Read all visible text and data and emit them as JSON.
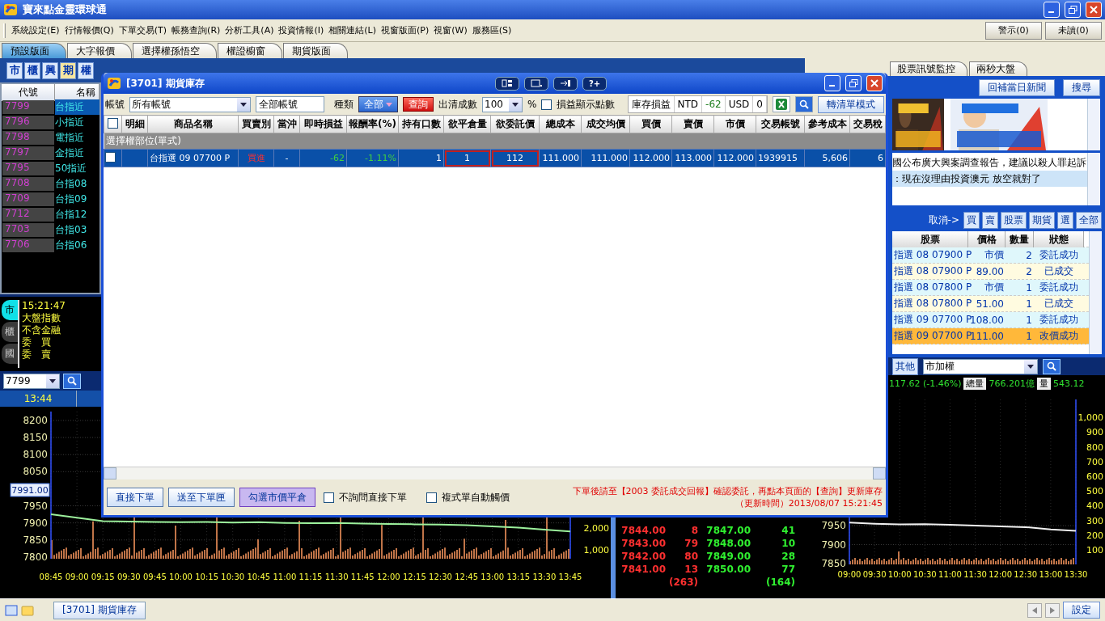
{
  "app": {
    "title": "寶來點金靈環球通"
  },
  "menu": [
    "系統設定(E)",
    "行情報價(Q)",
    "下單交易(T)",
    "帳務查詢(R)",
    "分析工具(A)",
    "投資情報(I)",
    "相關連結(L)",
    "視窗版面(P)",
    "視窗(W)",
    "服務區(S)"
  ],
  "alerts": [
    "警示(0)",
    "未讀(0)"
  ],
  "layout_tabs": [
    {
      "label": "預設版面",
      "selected": true
    },
    {
      "label": "大字報價",
      "selected": false
    },
    {
      "label": "選擇權孫悟空",
      "selected": false
    },
    {
      "label": "權證櫥窗",
      "selected": false
    },
    {
      "label": "期貨版面",
      "selected": false
    }
  ],
  "market_buttons": [
    {
      "label": "市",
      "selected": false
    },
    {
      "label": "櫃",
      "selected": false
    },
    {
      "label": "興",
      "selected": false
    },
    {
      "label": "期",
      "selected": true
    },
    {
      "label": "權",
      "selected": false
    }
  ],
  "quote_list": {
    "columns": [
      "代號",
      "名稱"
    ],
    "rows": [
      {
        "code": "7799",
        "name": "台指近",
        "selected": true
      },
      {
        "code": "7796",
        "name": "小指近",
        "selected": false
      },
      {
        "code": "7798",
        "name": "電指近",
        "selected": false
      },
      {
        "code": "7797",
        "name": "金指近",
        "selected": false
      },
      {
        "code": "7795",
        "name": "50指近",
        "selected": false
      },
      {
        "code": "7708",
        "name": "台指08",
        "selected": false
      },
      {
        "code": "7709",
        "name": "台指09",
        "selected": false
      },
      {
        "code": "7712",
        "name": "台指12",
        "selected": false
      },
      {
        "code": "7703",
        "name": "台指03",
        "selected": false
      },
      {
        "code": "7706",
        "name": "台指06",
        "selected": false
      }
    ]
  },
  "index_panel": {
    "tabs": [
      {
        "label": "市",
        "selected": true
      },
      {
        "label": "櫃",
        "selected": false
      },
      {
        "label": "國",
        "selected": false
      }
    ],
    "lines": [
      "15:21:47",
      "大盤指數",
      "不含金融",
      "委　買",
      "委　賣"
    ]
  },
  "symbol_combo": {
    "value": "7799"
  },
  "chart_time": "13:44",
  "price_chart": {
    "chart_data": {
      "type": "line",
      "categories": [
        "08:45",
        "09:00",
        "09:15",
        "09:30",
        "09:45",
        "10:00",
        "10:15",
        "10:30",
        "10:45",
        "11:00",
        "11:15",
        "11:30",
        "11:45",
        "12:00",
        "12:15",
        "12:30",
        "12:45",
        "13:00",
        "13:15",
        "13:30",
        "13:45"
      ],
      "yticks": [
        7800,
        7850,
        7900,
        7950,
        8050,
        8100,
        8150,
        8200
      ],
      "ylim": [
        7795,
        8226
      ],
      "grid": true,
      "series": [
        {
          "color": "#9cf09c",
          "values": [
            7925,
            7915,
            7905,
            7904,
            7903,
            7902,
            7903,
            7901,
            7902,
            7900,
            7899,
            7900,
            7898,
            7897,
            7896,
            7895,
            7893,
            7890,
            7886,
            7880,
            7875
          ]
        }
      ]
    },
    "marker": "7991.00",
    "volume_ticks": [
      "2,000",
      "1,000"
    ]
  },
  "order_book": {
    "rows": [
      {
        "bid": "7844.00",
        "bid_qty": "8",
        "ask": "7847.00",
        "ask_qty": "41"
      },
      {
        "bid": "7843.00",
        "bid_qty": "79",
        "ask": "7848.00",
        "ask_qty": "10"
      },
      {
        "bid": "7842.00",
        "bid_qty": "80",
        "ask": "7849.00",
        "ask_qty": "28"
      },
      {
        "bid": "7841.00",
        "bid_qty": "13",
        "ask": "7850.00",
        "ask_qty": "77"
      }
    ],
    "bid_total": "(263)",
    "ask_total": "(164)"
  },
  "inventory_window": {
    "title": "[3701] 期貨庫存",
    "help_button": "?+",
    "account_label": "帳號",
    "account_select": "所有帳號",
    "account_field": "全部帳號",
    "type_label": "種類",
    "type_button": "全部",
    "query_button": "查詢",
    "clear_label": "出清成數",
    "clear_select": "100",
    "percent": "%",
    "points_option": {
      "label": "損益顯示點數",
      "checked": false
    },
    "pnl": {
      "label": "庫存損益",
      "ntd_label": "NTD",
      "ntd": "-62",
      "usd_label": "USD",
      "usd": "0"
    },
    "list_mode_button": "轉清單模式",
    "header_checked": false,
    "columns": [
      "明細",
      "商品名稱",
      "買賣別",
      "當沖",
      "即時損益",
      "報酬率(%)",
      "持有口數",
      "欲平倉量",
      "欲委託價",
      "總成本",
      "成交均價",
      "買價",
      "賣價",
      "市價",
      "交易帳號",
      "參考成本",
      "交易稅"
    ],
    "groups": [
      {
        "title": "選擇權部位(單式)",
        "rows": [
          {
            "selected": true,
            "checked": false,
            "cells": [
              "台指選 09 07700 P",
              "買進",
              "-",
              "-62",
              "-1.11%",
              "1",
              "1",
              "112",
              "111.000",
              "111.000",
              "112.000",
              "113.000",
              "112.000",
              "1939915",
              "5,606",
              "6"
            ]
          }
        ]
      }
    ],
    "actions": [
      {
        "label": "直接下單",
        "kind": "normal"
      },
      {
        "label": "送至下單匣",
        "kind": "normal"
      },
      {
        "label": "勾選市價平倉",
        "kind": "accent"
      }
    ],
    "options": [
      {
        "label": "不詢問直接下單",
        "checked": false
      },
      {
        "label": "複式單自動觸價",
        "checked": false
      }
    ],
    "notice": "下單後請至【2003 委託成交回報】確認委託，再點本頁面的【查詢】更新庫存",
    "updated": "（更新時間）2013/08/07 15:21:45"
  },
  "news_panel": {
    "tabs": [
      {
        "label": "股票訊號監控",
        "selected": false
      },
      {
        "label": "兩秒大盤",
        "selected": false
      }
    ],
    "buttons": [
      "回補當日新聞",
      "搜尋"
    ],
    "banners": [
      {
        "kind": "picture"
      },
      {
        "kind": "picture"
      }
    ],
    "headlines": [
      {
        "text": "國公布廣大興案調查報告，建議以殺人罪起訴",
        "selected": false
      },
      {
        "text": "：現在沒理由投資澳元 放空就對了",
        "selected": true
      }
    ]
  },
  "orders": {
    "cancel_label": "取消->",
    "filters": [
      "買",
      "賣",
      "股票",
      "期貨",
      "選",
      "全部"
    ],
    "columns": [
      "股票",
      "價格",
      "數量",
      "狀態"
    ],
    "rows": [
      {
        "product": "指選 08 07900 P",
        "price": "市價",
        "qty": "2",
        "status": "委託成功",
        "color": "#dff7fb"
      },
      {
        "product": "指選 08 07900 P",
        "price": "89.00",
        "qty": "2",
        "status": "已成交",
        "color": "#fffbe0"
      },
      {
        "product": "指選 08 07800 P",
        "price": "市價",
        "qty": "1",
        "status": "委託成功",
        "color": "#dff7fb"
      },
      {
        "product": "指選 08 07800 P",
        "price": "51.00",
        "qty": "1",
        "status": "已成交",
        "color": "#fffbe0"
      },
      {
        "product": "指選 09 07700 P",
        "price": "108.00",
        "qty": "1",
        "status": "委託成功",
        "color": "#dff7fb"
      },
      {
        "product": "指選 09 07700 P",
        "price": "111.00",
        "qty": "1",
        "status": "改價成功",
        "color": "#ffb83a"
      }
    ]
  },
  "index_chart": {
    "other_button": "其他",
    "combo": "市加權",
    "change": "117.62 (-1.46%)",
    "total_label": "總量",
    "total_value": "766.201億",
    "volume_label": "量",
    "volume_value": "543.12",
    "chart_data": {
      "type": "line",
      "categories": [
        "09:00",
        "09:30",
        "10:00",
        "10:30",
        "11:00",
        "11:30",
        "12:00",
        "12:30",
        "13:00",
        "13:30"
      ],
      "yticks": [
        7850,
        7900,
        7950
      ],
      "ylim": [
        7848,
        8282
      ],
      "grid": true,
      "series": [
        {
          "color": "#f0f0f0",
          "values": [
            7958,
            7955,
            7953,
            7954,
            7952,
            7950,
            7948,
            7946,
            7940,
            7936
          ]
        }
      ]
    },
    "volume_ticks": [
      "1,000",
      "900",
      "800",
      "700",
      "600",
      "500",
      "400",
      "300",
      "200",
      "100"
    ]
  },
  "taskbar": {
    "windows": [
      {
        "label": "[3701] 期貨庫存"
      }
    ],
    "settings": "設定"
  }
}
